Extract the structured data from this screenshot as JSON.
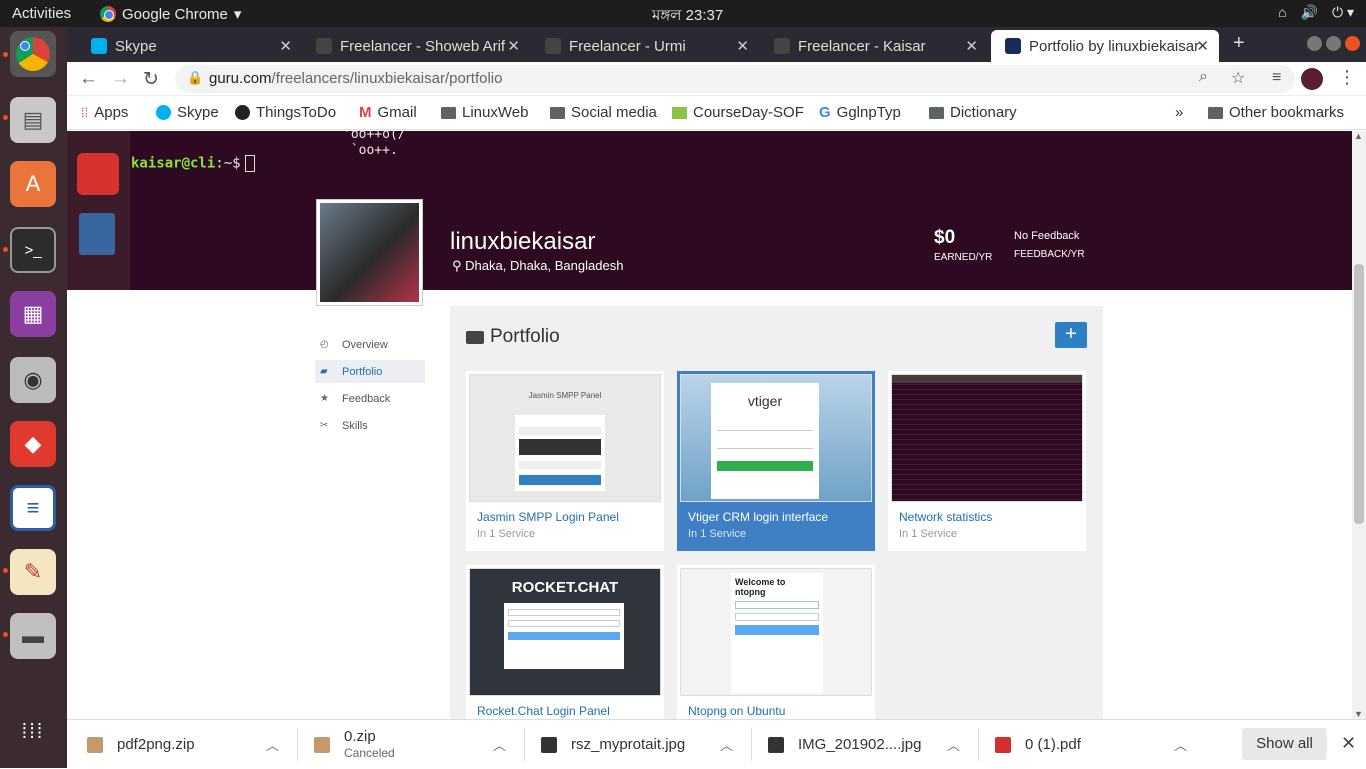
{
  "system": {
    "activities": "Activities",
    "app_name": "Google Chrome",
    "clock": "মঙ্গল 23:37"
  },
  "tabs": [
    {
      "label": "Skype",
      "active": false
    },
    {
      "label": "Freelancer - Showeb Arif",
      "active": false
    },
    {
      "label": "Freelancer - Urmi",
      "active": false
    },
    {
      "label": "Freelancer - Kaisar",
      "active": false
    },
    {
      "label": "Portfolio by linuxbiekaisar",
      "active": true
    }
  ],
  "address": {
    "domain": "guru.com",
    "path": "/freelancers/linuxbiekaisar/portfolio"
  },
  "bookmarks": {
    "items": [
      "Apps",
      "Skype",
      "ThingsToDo",
      "Gmail",
      "LinuxWeb",
      "Social media",
      "CourseDay-SOF",
      "GglnpTyp",
      "Dictionary"
    ],
    "overflow": "»",
    "other": "Other bookmarks"
  },
  "terminal": {
    "art_line1": "'oo++o(/",
    "art_line2": "`oo++.",
    "prompt_user": "kaisar@cli",
    "prompt_path": ":~$"
  },
  "profile": {
    "username": "linuxbiekaisar",
    "location": "Dhaka, Dhaka, Bangladesh",
    "earned_value": "$0",
    "earned_label": "EARNED/YR",
    "feedback_value": "No Feedback",
    "feedback_label": "FEEDBACK/YR"
  },
  "leftnav": [
    {
      "label": "Overview",
      "active": false
    },
    {
      "label": "Portfolio",
      "active": true
    },
    {
      "label": "Feedback",
      "active": false
    },
    {
      "label": "Skills",
      "active": false
    }
  ],
  "portfolio": {
    "title": "Portfolio",
    "add_label": "+",
    "items": [
      {
        "title": "Jasmin SMPP Login Panel",
        "sub": "In 1 Service",
        "thumb_title": "Jasmin SMPP Panel"
      },
      {
        "title": "Vtiger CRM login interface",
        "sub": "In 1 Service",
        "thumb_title": "vtiger"
      },
      {
        "title": "Network statistics",
        "sub": "In 1 Service",
        "thumb_title": ""
      },
      {
        "title": "Rocket.Chat Login Panel",
        "sub": "",
        "thumb_title": "ROCKET.CHAT"
      },
      {
        "title": "Ntopng on Ubuntu",
        "sub": "",
        "thumb_title": "Welcome to ntopng"
      }
    ]
  },
  "downloads": [
    {
      "name": "pdf2png.zip",
      "status": ""
    },
    {
      "name": "0.zip",
      "status": "Canceled"
    },
    {
      "name": "rsz_myprotait.jpg",
      "status": ""
    },
    {
      "name": "IMG_201902....jpg",
      "status": ""
    },
    {
      "name": "0 (1).pdf",
      "status": ""
    }
  ],
  "show_all": "Show all",
  "colors": {
    "accent": "#2f7fc4",
    "hero": "#2d0922",
    "dock": "#3b2a2f"
  }
}
